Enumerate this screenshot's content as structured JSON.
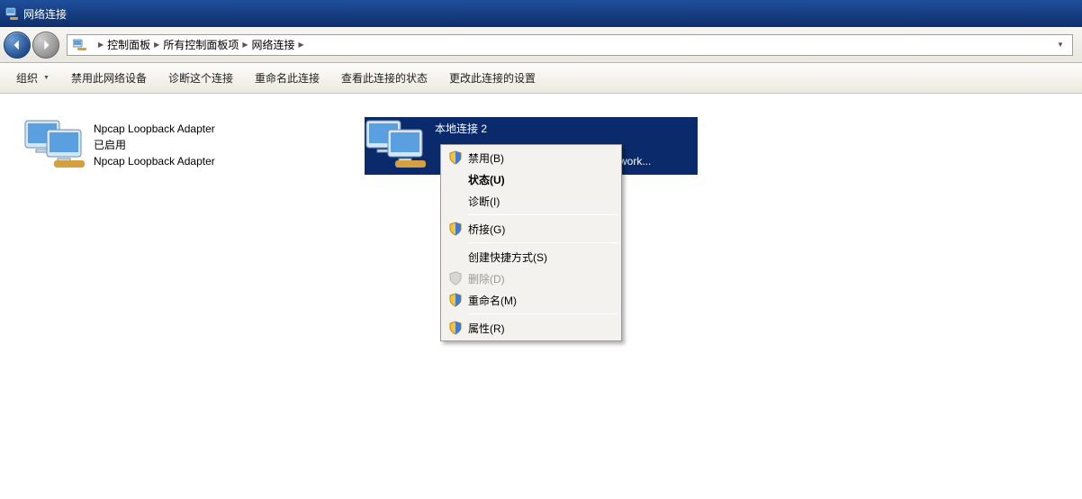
{
  "window": {
    "title": "网络连接"
  },
  "breadcrumb": {
    "parts": [
      "控制面板",
      "所有控制面板项",
      "网络连接"
    ]
  },
  "toolbar": {
    "org": "组织",
    "disable": "禁用此网络设备",
    "diagnose": "诊断这个连接",
    "rename": "重命名此连接",
    "status": "查看此连接的状态",
    "settings": "更改此连接的设置"
  },
  "connections": [
    {
      "name": "Npcap Loopback Adapter",
      "state": "已启用",
      "device": "Npcap Loopback Adapter"
    },
    {
      "name": "本地连接 2",
      "state": "",
      "device": "etwork..."
    }
  ],
  "context_menu": {
    "disable": "禁用(B)",
    "status": "状态(U)",
    "diagnose": "诊断(I)",
    "bridge": "桥接(G)",
    "shortcut": "创建快捷方式(S)",
    "delete": "删除(D)",
    "rename": "重命名(M)",
    "properties": "属性(R)"
  }
}
